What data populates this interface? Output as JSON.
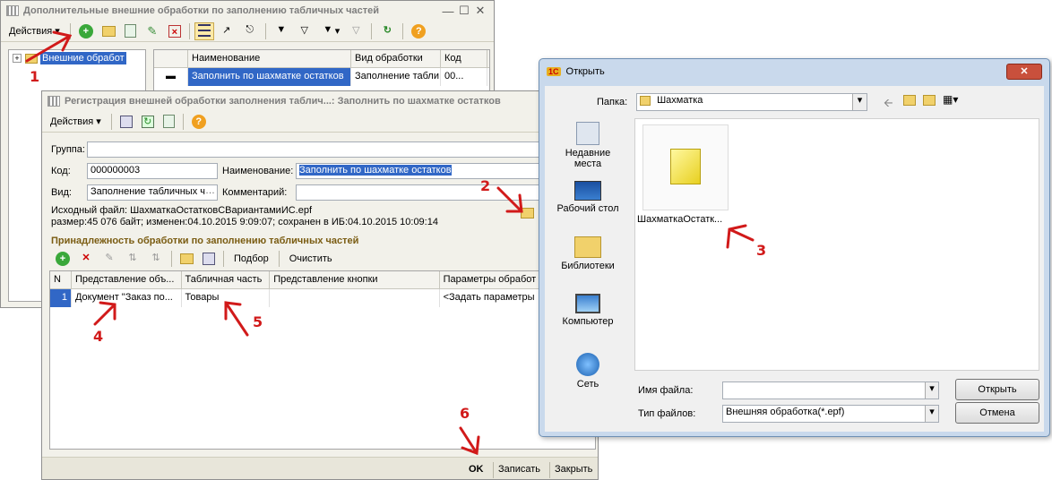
{
  "win1": {
    "title": "Дополнительные внешние обработки по заполнению табличных частей",
    "actions": "Действия",
    "tree_item": "Внешние обработ",
    "columns": [
      "Наименование",
      "Вид обработки",
      "Код"
    ],
    "row": [
      "Заполнить по шахматке остатков",
      "Заполнение табли...",
      "00..."
    ]
  },
  "win2": {
    "title": "Регистрация внешней обработки заполнения таблич...: Заполнить по шахматке остатков",
    "actions": "Действия",
    "group_label": "Группа:",
    "group_value": "",
    "code_label": "Код:",
    "code_value": "000000003",
    "name_label": "Наименование:",
    "name_value": "Заполнить по шахматке остатков",
    "kind_label": "Вид:",
    "kind_value": "Заполнение табличных ч",
    "comment_label": "Комментарий:",
    "comment_value": "",
    "source_line": "Исходный файл: ШахматкаОстатковСВариантамиИС.epf",
    "size_line": "размер:45 076 байт; изменен:04.10.2015 9:09:07; сохранен в ИБ:04.10.2015 10:09:14",
    "section_title": "Принадлежность обработки по заполнению табличных частей",
    "select_btn": "Подбор",
    "clear_btn": "Очистить",
    "columns": [
      "N",
      "Представление объ...",
      "Табличная часть",
      "Представление кнопки",
      "Параметры обработ"
    ],
    "row": [
      "1",
      "Документ \"Заказ по...",
      "Товары",
      "",
      "<Задать параметры"
    ],
    "ok": "OK",
    "write": "Записать",
    "close": "Закрыть"
  },
  "open_dialog": {
    "title": "Открыть",
    "folder_label": "Папка:",
    "folder_value": "Шахматка",
    "places": [
      "Недавние места",
      "Рабочий стол",
      "Библиотеки",
      "Компьютер",
      "Сеть"
    ],
    "file_name": "ШахматкаОстатк...",
    "filename_label": "Имя файла:",
    "filename_value": "",
    "filetype_label": "Тип файлов:",
    "filetype_value": "Внешняя обработка(*.epf)",
    "open_btn": "Открыть",
    "cancel_btn": "Отмена"
  },
  "annotations": [
    "1",
    "2",
    "3",
    "4",
    "5",
    "6"
  ],
  "colors": {
    "selection": "#3167c6",
    "annotation": "#d11a1a",
    "window_bg": "#f2f1ea"
  }
}
